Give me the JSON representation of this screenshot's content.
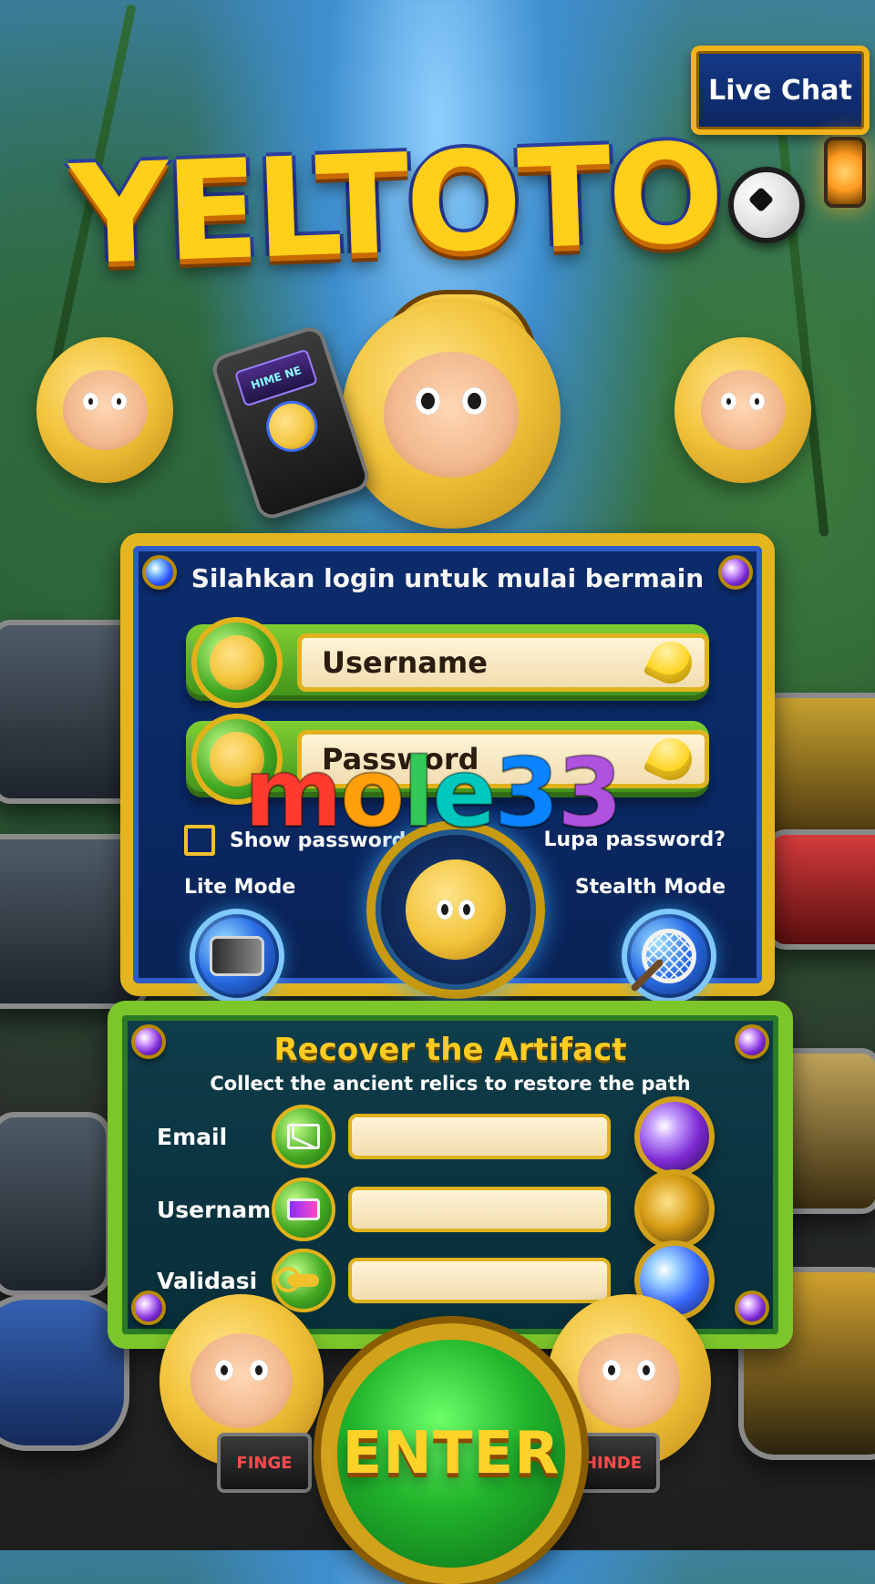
{
  "header": {
    "logo_text": "YELTOTO",
    "live_chat_label": "Live Chat"
  },
  "login": {
    "title": "Silahkan login untuk mulai bermain",
    "username_placeholder": "Username",
    "password_placeholder": "Password",
    "show_password_label": "Show password",
    "forgot_password_label": "Lupa password?",
    "lite_mode_label": "Lite Mode",
    "stealth_mode_label": "Stealth Mode"
  },
  "watermark": {
    "text": "mole33",
    "colors": [
      "#ff3b30",
      "#ff9f0a",
      "#34c759",
      "#00c7be",
      "#0a84ff",
      "#af52de"
    ]
  },
  "recover": {
    "title": "Recover the Artifact",
    "subtitle": "Collect the ancient relics to restore the path",
    "rows": [
      {
        "label": "Email",
        "icon": "mail-icon",
        "gem": "purple-gem"
      },
      {
        "label": "Username",
        "icon": "battery-icon",
        "gem": "swirl-coin"
      },
      {
        "label": "Validasi",
        "icon": "key-icon",
        "gem": "blue-gem"
      }
    ]
  },
  "footer": {
    "enter_label": "ENTER",
    "chip_left_text": "FINGE",
    "chip_right_text": "HINDE"
  },
  "device": {
    "screen_text": "HIME NE"
  },
  "colors": {
    "panel_gold": "#e4b51f",
    "panel_navy": "#0c2b6a",
    "recover_green": "#7cc52a",
    "recover_teal": "#0f3e4a",
    "enter_green": "#22b52c",
    "title_yellow": "#ffcf1a"
  }
}
